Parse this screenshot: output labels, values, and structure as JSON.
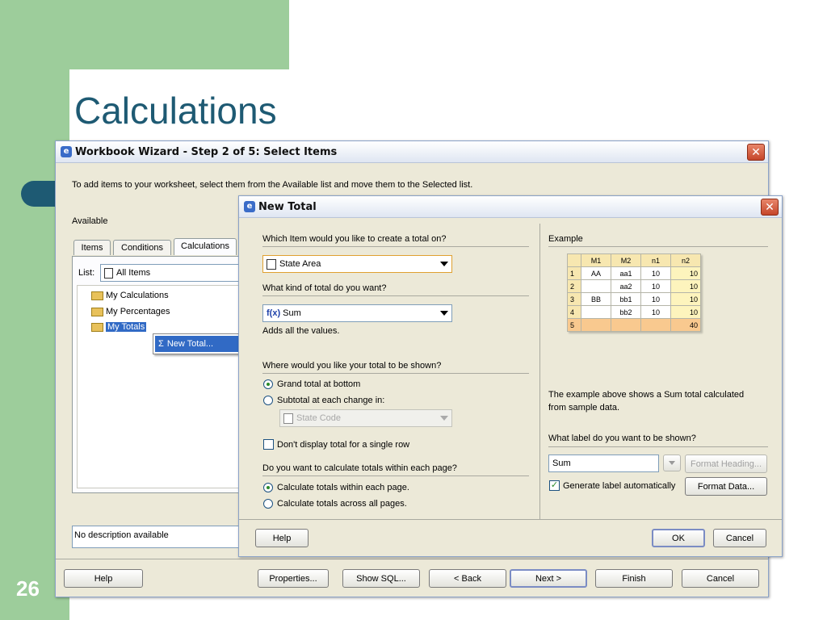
{
  "slide": {
    "title": "Calculations",
    "number": "26"
  },
  "wizard": {
    "title": "Workbook Wizard - Step 2 of 5: Select Items",
    "instructions": "To add items to your worksheet, select them from the Available list and move them to the Selected list.",
    "available_label": "Available",
    "tabs": [
      "Items",
      "Conditions",
      "Calculations"
    ],
    "list_label": "List:",
    "list_value": "All Items",
    "tree": [
      "My Calculations",
      "My Percentages",
      "My Totals"
    ],
    "context_menu_item": "New Total...",
    "description": "No description available",
    "buttons": {
      "help": "Help",
      "properties": "Properties...",
      "show_sql": "Show SQL...",
      "back": "< Back",
      "next": "Next >",
      "finish": "Finish",
      "cancel": "Cancel"
    }
  },
  "new_total": {
    "title": "New Total",
    "q_item": "Which Item would you like to create a total on?",
    "item_value": "State Area",
    "q_kind": "What kind of total do you want?",
    "kind_value": "Sum",
    "kind_desc": "Adds all the values.",
    "q_where": "Where would you like your total to be shown?",
    "opt_grand": "Grand total at bottom",
    "opt_subtotal": "Subtotal at each change in:",
    "subtotal_value": "State Code",
    "opt_single_row": "Don't display total for a single row",
    "q_page": "Do you want to calculate totals within each page?",
    "opt_within": "Calculate totals within each page.",
    "opt_across": "Calculate totals across all pages.",
    "example_label": "Example",
    "example_table": {
      "headers": [
        "",
        "M1",
        "M2",
        "n1",
        "n2"
      ],
      "rows": [
        [
          "1",
          "AA",
          "aa1",
          "10",
          "10"
        ],
        [
          "2",
          "",
          "aa2",
          "10",
          "10"
        ],
        [
          "3",
          "BB",
          "bb1",
          "10",
          "10"
        ],
        [
          "4",
          "",
          "bb2",
          "10",
          "10"
        ],
        [
          "5",
          "",
          "",
          "",
          "40"
        ]
      ]
    },
    "example_desc_1": "The example above shows a Sum total calculated",
    "example_desc_2": "from sample data.",
    "q_label": "What label do you want to be shown?",
    "label_value": "Sum",
    "format_heading": "Format Heading...",
    "gen_label": "Generate label automatically",
    "format_data": "Format Data...",
    "buttons": {
      "help": "Help",
      "ok": "OK",
      "cancel": "Cancel"
    }
  }
}
